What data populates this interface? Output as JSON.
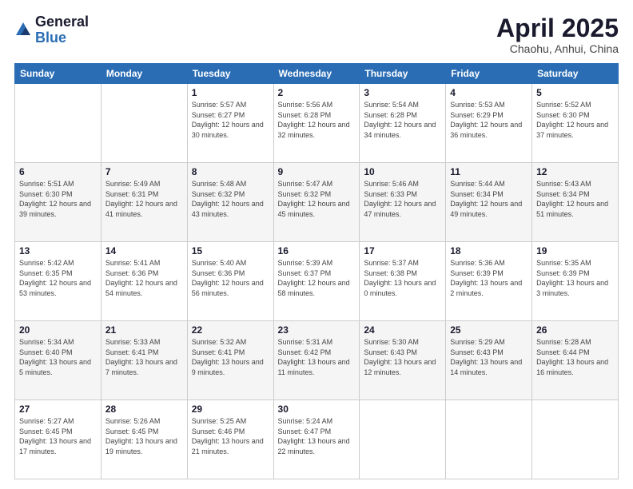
{
  "header": {
    "logo_general": "General",
    "logo_blue": "Blue",
    "title": "April 2025",
    "location": "Chaohu, Anhui, China"
  },
  "weekdays": [
    "Sunday",
    "Monday",
    "Tuesday",
    "Wednesday",
    "Thursday",
    "Friday",
    "Saturday"
  ],
  "weeks": [
    [
      {
        "day": "",
        "info": ""
      },
      {
        "day": "",
        "info": ""
      },
      {
        "day": "1",
        "info": "Sunrise: 5:57 AM\nSunset: 6:27 PM\nDaylight: 12 hours\nand 30 minutes."
      },
      {
        "day": "2",
        "info": "Sunrise: 5:56 AM\nSunset: 6:28 PM\nDaylight: 12 hours\nand 32 minutes."
      },
      {
        "day": "3",
        "info": "Sunrise: 5:54 AM\nSunset: 6:28 PM\nDaylight: 12 hours\nand 34 minutes."
      },
      {
        "day": "4",
        "info": "Sunrise: 5:53 AM\nSunset: 6:29 PM\nDaylight: 12 hours\nand 36 minutes."
      },
      {
        "day": "5",
        "info": "Sunrise: 5:52 AM\nSunset: 6:30 PM\nDaylight: 12 hours\nand 37 minutes."
      }
    ],
    [
      {
        "day": "6",
        "info": "Sunrise: 5:51 AM\nSunset: 6:30 PM\nDaylight: 12 hours\nand 39 minutes."
      },
      {
        "day": "7",
        "info": "Sunrise: 5:49 AM\nSunset: 6:31 PM\nDaylight: 12 hours\nand 41 minutes."
      },
      {
        "day": "8",
        "info": "Sunrise: 5:48 AM\nSunset: 6:32 PM\nDaylight: 12 hours\nand 43 minutes."
      },
      {
        "day": "9",
        "info": "Sunrise: 5:47 AM\nSunset: 6:32 PM\nDaylight: 12 hours\nand 45 minutes."
      },
      {
        "day": "10",
        "info": "Sunrise: 5:46 AM\nSunset: 6:33 PM\nDaylight: 12 hours\nand 47 minutes."
      },
      {
        "day": "11",
        "info": "Sunrise: 5:44 AM\nSunset: 6:34 PM\nDaylight: 12 hours\nand 49 minutes."
      },
      {
        "day": "12",
        "info": "Sunrise: 5:43 AM\nSunset: 6:34 PM\nDaylight: 12 hours\nand 51 minutes."
      }
    ],
    [
      {
        "day": "13",
        "info": "Sunrise: 5:42 AM\nSunset: 6:35 PM\nDaylight: 12 hours\nand 53 minutes."
      },
      {
        "day": "14",
        "info": "Sunrise: 5:41 AM\nSunset: 6:36 PM\nDaylight: 12 hours\nand 54 minutes."
      },
      {
        "day": "15",
        "info": "Sunrise: 5:40 AM\nSunset: 6:36 PM\nDaylight: 12 hours\nand 56 minutes."
      },
      {
        "day": "16",
        "info": "Sunrise: 5:39 AM\nSunset: 6:37 PM\nDaylight: 12 hours\nand 58 minutes."
      },
      {
        "day": "17",
        "info": "Sunrise: 5:37 AM\nSunset: 6:38 PM\nDaylight: 13 hours\nand 0 minutes."
      },
      {
        "day": "18",
        "info": "Sunrise: 5:36 AM\nSunset: 6:39 PM\nDaylight: 13 hours\nand 2 minutes."
      },
      {
        "day": "19",
        "info": "Sunrise: 5:35 AM\nSunset: 6:39 PM\nDaylight: 13 hours\nand 3 minutes."
      }
    ],
    [
      {
        "day": "20",
        "info": "Sunrise: 5:34 AM\nSunset: 6:40 PM\nDaylight: 13 hours\nand 5 minutes."
      },
      {
        "day": "21",
        "info": "Sunrise: 5:33 AM\nSunset: 6:41 PM\nDaylight: 13 hours\nand 7 minutes."
      },
      {
        "day": "22",
        "info": "Sunrise: 5:32 AM\nSunset: 6:41 PM\nDaylight: 13 hours\nand 9 minutes."
      },
      {
        "day": "23",
        "info": "Sunrise: 5:31 AM\nSunset: 6:42 PM\nDaylight: 13 hours\nand 11 minutes."
      },
      {
        "day": "24",
        "info": "Sunrise: 5:30 AM\nSunset: 6:43 PM\nDaylight: 13 hours\nand 12 minutes."
      },
      {
        "day": "25",
        "info": "Sunrise: 5:29 AM\nSunset: 6:43 PM\nDaylight: 13 hours\nand 14 minutes."
      },
      {
        "day": "26",
        "info": "Sunrise: 5:28 AM\nSunset: 6:44 PM\nDaylight: 13 hours\nand 16 minutes."
      }
    ],
    [
      {
        "day": "27",
        "info": "Sunrise: 5:27 AM\nSunset: 6:45 PM\nDaylight: 13 hours\nand 17 minutes."
      },
      {
        "day": "28",
        "info": "Sunrise: 5:26 AM\nSunset: 6:45 PM\nDaylight: 13 hours\nand 19 minutes."
      },
      {
        "day": "29",
        "info": "Sunrise: 5:25 AM\nSunset: 6:46 PM\nDaylight: 13 hours\nand 21 minutes."
      },
      {
        "day": "30",
        "info": "Sunrise: 5:24 AM\nSunset: 6:47 PM\nDaylight: 13 hours\nand 22 minutes."
      },
      {
        "day": "",
        "info": ""
      },
      {
        "day": "",
        "info": ""
      },
      {
        "day": "",
        "info": ""
      }
    ]
  ]
}
